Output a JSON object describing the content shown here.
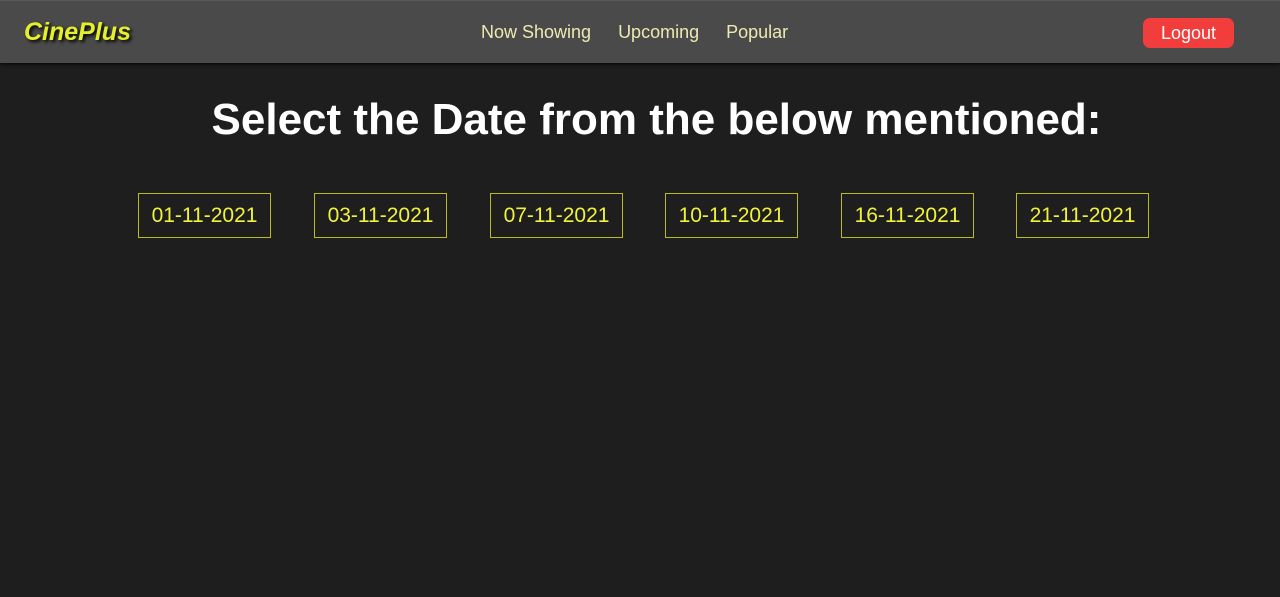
{
  "header": {
    "logo": "CinePlus",
    "nav": [
      "Now Showing",
      "Upcoming",
      "Popular"
    ],
    "logout_label": "Logout"
  },
  "main": {
    "title": "Select the Date from the below mentioned:",
    "dates": [
      "01-11-2021",
      "03-11-2021",
      "07-11-2021",
      "10-11-2021",
      "16-11-2021",
      "21-11-2021"
    ]
  },
  "colors": {
    "background": "#1e1e1e",
    "navbar": "#4a4a4a",
    "logo": "#e5ef2a",
    "nav_text": "#eceab0",
    "logout_button": "#f23d3d",
    "date_text": "#f1f23a",
    "date_border": "#b9bb1c"
  }
}
